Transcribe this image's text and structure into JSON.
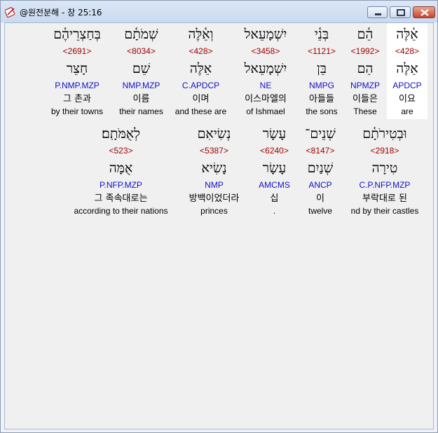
{
  "window": {
    "title": "@원전분해 - 창 25:16",
    "minimize_icon": "minimize-icon",
    "maximize_icon": "maximize-icon",
    "close_icon": "close-icon",
    "app_icon": "pen-book-icon"
  },
  "colors": {
    "strong": "#a00000",
    "parse": "#1010c8",
    "highlight": "#ffffff"
  },
  "verse": {
    "rows": [
      {
        "words": [
          {
            "text": "אֵ֫לֶּה",
            "strong": "<428>",
            "lemma": "אֵלֶּה",
            "parse": "APDCP",
            "korean": "이요",
            "english": "are"
          },
          {
            "text": "הֵ֫ם",
            "strong": "<1992>",
            "lemma": "הֵם",
            "parse": "NPMZP",
            "korean": "이들은",
            "english": "These"
          },
          {
            "text": "בְּנֵ֫י",
            "strong": "<1121>",
            "lemma": "בֵּן",
            "parse": "NMPG",
            "korean": "아들들",
            "english": "the sons"
          },
          {
            "text": "יִשְׁמָעֵאל",
            "strong": "<3458>",
            "lemma": "יִשְׁמָעֵאל",
            "parse": "NE",
            "korean": "이스마엘의",
            "english": "of Ishmael"
          },
          {
            "text": "וְאֵ֫לֶּה",
            "strong": "<428>",
            "lemma": "אֵלֶּה",
            "parse": "C.APDCP",
            "korean": "이며",
            "english": "and these are"
          },
          {
            "text": "שְׁמֹתָ֫ם",
            "strong": "<8034>",
            "lemma": "שֵׁם",
            "parse": "NMP.MZP",
            "korean": "이름",
            "english": "their names"
          },
          {
            "text": "בְּחַצְרֵיהֶ֫ם",
            "strong": "<2691>",
            "lemma": "חָצֵר",
            "parse": "P.NMP.MZP",
            "korean": "그 촌과",
            "english": "by their towns"
          }
        ]
      },
      {
        "words": [
          {
            "text": "וּבְטִירֹתָ֫ם",
            "strong": "<2918>",
            "lemma": "טִירָה",
            "parse": "C.P.NFP.MZP",
            "korean": "부락대로 된",
            "english": "nd by their castles"
          },
          {
            "text": "שְׁנֵים־",
            "strong": "<8147>",
            "lemma": "שְׁנַיִם",
            "parse": "ANCP",
            "korean": "이",
            "english": "twelve"
          },
          {
            "text": "עָשָׂר",
            "strong": "<6240>",
            "lemma": "עָשָׂר",
            "parse": "AMCMS",
            "korean": "십",
            "english": "."
          },
          {
            "text": "נְשִׂיאִם",
            "strong": "<5387>",
            "lemma": "נָשִׂיא",
            "parse": "NMP",
            "korean": "방백이었더라",
            "english": "princes"
          },
          {
            "text": "לְאֻמֹּתָֽם׃",
            "strong": "<523>",
            "lemma": "אֻמָּה",
            "parse": "P.NFP.MZP",
            "korean": "그 족속대로는",
            "english": "according to their nations"
          }
        ]
      }
    ]
  }
}
